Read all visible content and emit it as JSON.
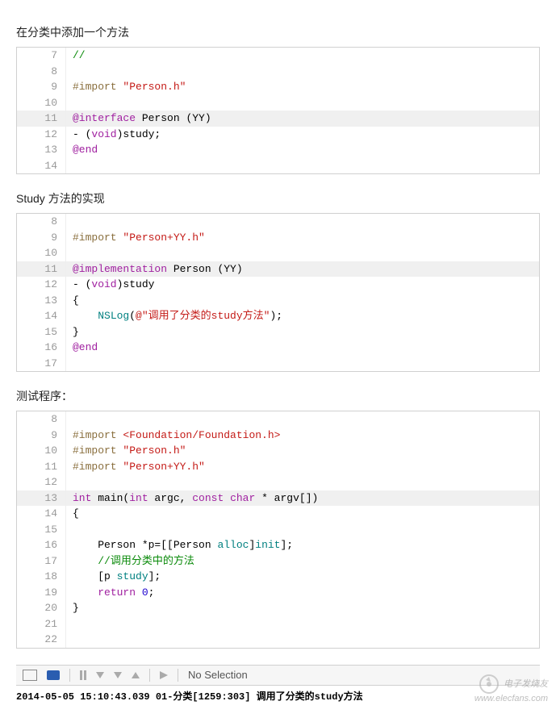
{
  "section1": {
    "title": "在分类中添加一个方法",
    "lines": [
      {
        "n": "7",
        "hl": false,
        "segs": [
          {
            "t": "//",
            "c": "c-comment-green"
          }
        ]
      },
      {
        "n": "8",
        "hl": false,
        "segs": []
      },
      {
        "n": "9",
        "hl": false,
        "segs": [
          {
            "t": "#import ",
            "c": "c-keyword-brown"
          },
          {
            "t": "\"Person.h\"",
            "c": "c-string-red"
          }
        ]
      },
      {
        "n": "10",
        "hl": false,
        "segs": []
      },
      {
        "n": "11",
        "hl": true,
        "segs": [
          {
            "t": "@interface ",
            "c": "c-purple"
          },
          {
            "t": "Person ",
            "c": "c-black"
          },
          {
            "t": "(",
            "c": "c-black"
          },
          {
            "t": "YY",
            "c": "c-black"
          },
          {
            "t": ")",
            "c": "c-black"
          }
        ]
      },
      {
        "n": "12",
        "hl": false,
        "segs": [
          {
            "t": "- (",
            "c": "c-black"
          },
          {
            "t": "void",
            "c": "c-purple"
          },
          {
            "t": ")study;",
            "c": "c-black"
          }
        ]
      },
      {
        "n": "13",
        "hl": false,
        "segs": [
          {
            "t": "@end",
            "c": "c-purple"
          }
        ]
      },
      {
        "n": "14",
        "hl": false,
        "segs": []
      }
    ]
  },
  "section2": {
    "title": "Study 方法的实现",
    "lines": [
      {
        "n": "8",
        "hl": false,
        "segs": []
      },
      {
        "n": "9",
        "hl": false,
        "segs": [
          {
            "t": "#import ",
            "c": "c-keyword-brown"
          },
          {
            "t": "\"Person+YY.h\"",
            "c": "c-string-red"
          }
        ]
      },
      {
        "n": "10",
        "hl": false,
        "segs": []
      },
      {
        "n": "11",
        "hl": true,
        "segs": [
          {
            "t": "@implementation ",
            "c": "c-purple"
          },
          {
            "t": "Person ",
            "c": "c-black"
          },
          {
            "t": "(",
            "c": "c-black"
          },
          {
            "t": "YY",
            "c": "c-black"
          },
          {
            "t": ")",
            "c": "c-black"
          }
        ]
      },
      {
        "n": "12",
        "hl": false,
        "segs": [
          {
            "t": "- (",
            "c": "c-black"
          },
          {
            "t": "void",
            "c": "c-purple"
          },
          {
            "t": ")study",
            "c": "c-black"
          }
        ]
      },
      {
        "n": "13",
        "hl": false,
        "segs": [
          {
            "t": "{",
            "c": "c-black"
          }
        ]
      },
      {
        "n": "14",
        "hl": false,
        "segs": [
          {
            "t": "    ",
            "c": "c-black"
          },
          {
            "t": "NSLog",
            "c": "c-teal"
          },
          {
            "t": "(",
            "c": "c-black"
          },
          {
            "t": "@\"调用了分类的study方法\"",
            "c": "c-string-red"
          },
          {
            "t": ");",
            "c": "c-black"
          }
        ]
      },
      {
        "n": "15",
        "hl": false,
        "segs": [
          {
            "t": "}",
            "c": "c-black"
          }
        ]
      },
      {
        "n": "16",
        "hl": false,
        "segs": [
          {
            "t": "@end",
            "c": "c-purple"
          }
        ]
      },
      {
        "n": "17",
        "hl": false,
        "segs": []
      }
    ]
  },
  "section3": {
    "title": "测试程序：",
    "lines": [
      {
        "n": "8",
        "hl": false,
        "segs": []
      },
      {
        "n": "9",
        "hl": false,
        "segs": [
          {
            "t": "#import ",
            "c": "c-keyword-brown"
          },
          {
            "t": "<Foundation/Foundation.h>",
            "c": "c-string-red"
          }
        ]
      },
      {
        "n": "10",
        "hl": false,
        "segs": [
          {
            "t": "#import ",
            "c": "c-keyword-brown"
          },
          {
            "t": "\"Person.h\"",
            "c": "c-string-red"
          }
        ]
      },
      {
        "n": "11",
        "hl": false,
        "segs": [
          {
            "t": "#import ",
            "c": "c-keyword-brown"
          },
          {
            "t": "\"Person+YY.h\"",
            "c": "c-string-red"
          }
        ]
      },
      {
        "n": "12",
        "hl": false,
        "segs": []
      },
      {
        "n": "13",
        "hl": true,
        "segs": [
          {
            "t": "int",
            "c": "c-purple"
          },
          {
            "t": " main(",
            "c": "c-black"
          },
          {
            "t": "int",
            "c": "c-purple"
          },
          {
            "t": " argc, ",
            "c": "c-black"
          },
          {
            "t": "const",
            "c": "c-purple"
          },
          {
            "t": " ",
            "c": "c-black"
          },
          {
            "t": "char",
            "c": "c-purple"
          },
          {
            "t": " * argv[])",
            "c": "c-black"
          }
        ]
      },
      {
        "n": "14",
        "hl": false,
        "segs": [
          {
            "t": "{",
            "c": "c-black"
          }
        ]
      },
      {
        "n": "15",
        "hl": false,
        "segs": []
      },
      {
        "n": "16",
        "hl": false,
        "segs": [
          {
            "t": "    Person *p=[[",
            "c": "c-black"
          },
          {
            "t": "Person",
            "c": "c-black"
          },
          {
            "t": " ",
            "c": "c-black"
          },
          {
            "t": "alloc",
            "c": "c-teal"
          },
          {
            "t": "]",
            "c": "c-black"
          },
          {
            "t": "init",
            "c": "c-teal"
          },
          {
            "t": "];",
            "c": "c-black"
          }
        ]
      },
      {
        "n": "17",
        "hl": false,
        "segs": [
          {
            "t": "    ",
            "c": "c-black"
          },
          {
            "t": "//调用分类中的方法",
            "c": "c-comment-green"
          }
        ]
      },
      {
        "n": "18",
        "hl": false,
        "segs": [
          {
            "t": "    [p ",
            "c": "c-black"
          },
          {
            "t": "study",
            "c": "c-teal"
          },
          {
            "t": "];",
            "c": "c-black"
          }
        ]
      },
      {
        "n": "19",
        "hl": false,
        "segs": [
          {
            "t": "    ",
            "c": "c-black"
          },
          {
            "t": "return",
            "c": "c-purple"
          },
          {
            "t": " ",
            "c": "c-black"
          },
          {
            "t": "0",
            "c": "c-blue"
          },
          {
            "t": ";",
            "c": "c-black"
          }
        ]
      },
      {
        "n": "20",
        "hl": false,
        "segs": [
          {
            "t": "}",
            "c": "c-black"
          }
        ]
      },
      {
        "n": "21",
        "hl": false,
        "segs": []
      },
      {
        "n": "22",
        "hl": false,
        "segs": []
      }
    ]
  },
  "toolbar": {
    "no_selection": "No Selection"
  },
  "console": "2014-05-05 15:10:43.039 01-分类[1259:303] 调用了分类的study方法",
  "watermark": {
    "line1": "电子发烧友",
    "line2": "www.elecfans.com"
  }
}
